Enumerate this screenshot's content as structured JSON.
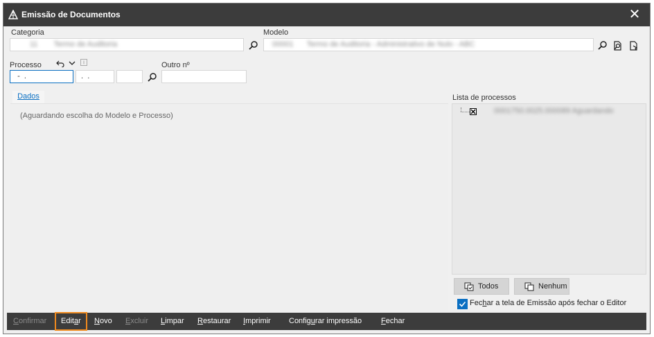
{
  "window": {
    "title": "Emissão de Documentos",
    "logo_icon": "document-logo-icon",
    "close_icon": "close-icon"
  },
  "categoria": {
    "label": "Categoria",
    "value": "Termo de Auditoria",
    "code": "11"
  },
  "modelo": {
    "label": "Modelo",
    "value": "Termo de Auditoria - Administrativo de Nulo - ABC",
    "code": "00001"
  },
  "processo": {
    "label": "Processo",
    "part1": "  -  .",
    "part2": " .  .",
    "part3": ""
  },
  "outro": {
    "label": "Outro nº",
    "value": ""
  },
  "tab": {
    "label": "Dados"
  },
  "panel": {
    "message": "(Aguardando escolha do Modelo e Processo)"
  },
  "lista": {
    "title": "Lista de processos",
    "items": [
      {
        "text": "0001750.0025.000089 Aguardando",
        "checked": true
      }
    ]
  },
  "selection": {
    "todos": "Todos",
    "nenhum": "Nenhum"
  },
  "option": {
    "label_pre": "Fec",
    "label_ul": "h",
    "label_post": "ar a tela de Emissão após fechar o Editor",
    "checked": true
  },
  "toolbar": {
    "confirmar_ul": "C",
    "confirmar_rest": "onfirmar",
    "editar_pre": "Edit",
    "editar_ul": "a",
    "editar_post": "r",
    "novo_ul": "N",
    "novo_rest": "ovo",
    "excluir_ul": "E",
    "excluir_rest": "xcluir",
    "limpar_ul": "L",
    "limpar_rest": "impar",
    "restaurar_ul": "R",
    "restaurar_rest": "estaurar",
    "imprimir_ul": "I",
    "imprimir_rest": "mprimir",
    "configurar_pre": "Config",
    "configurar_ul": "u",
    "configurar_post": "rar impressão",
    "fechar_ul": "F",
    "fechar_rest": "echar"
  },
  "colors": {
    "titlebar": "#3c3c3c",
    "accent": "#0a6fc2",
    "focus": "#f08a1e"
  }
}
